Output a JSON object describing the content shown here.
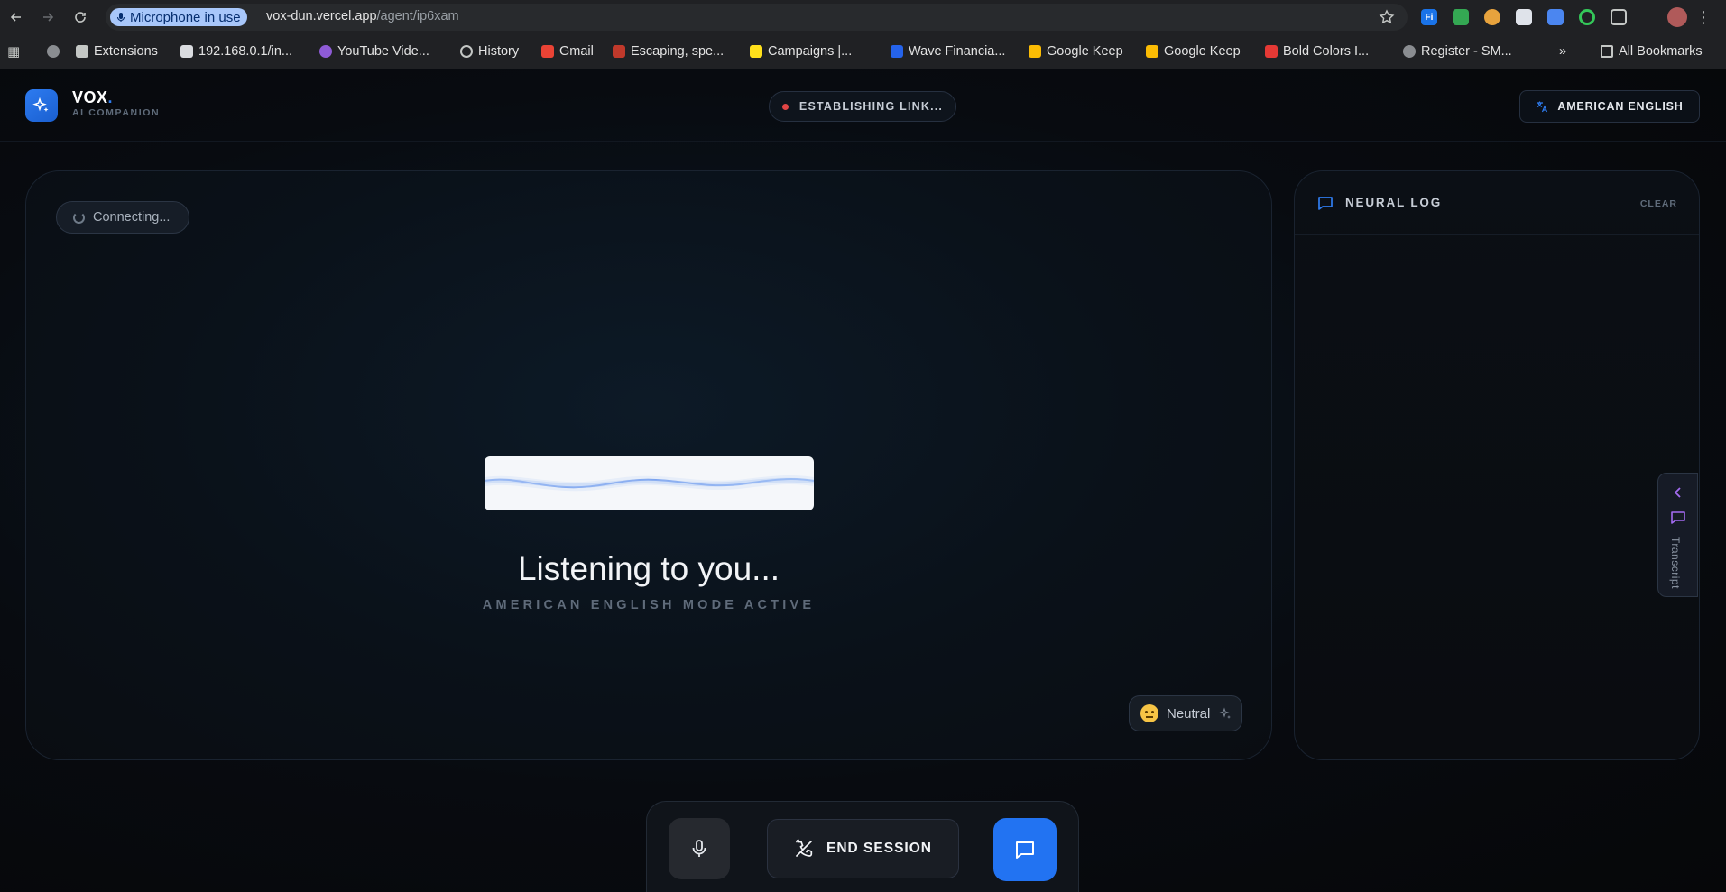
{
  "browser": {
    "mic_chip": "Microphone in use",
    "url_host": "vox-dun.vercel.app",
    "url_path": "/agent/ip6xam",
    "bookmarks": [
      {
        "label": "Extensions",
        "icon": "puzzle-icon"
      },
      {
        "label": "192.168.0.1/in...",
        "icon": "router-icon"
      },
      {
        "label": "YouTube Vide...",
        "icon": "download-icon"
      },
      {
        "label": "History",
        "icon": "history-icon"
      },
      {
        "label": "Gmail",
        "icon": "gmail-icon"
      },
      {
        "label": "Escaping, spe...",
        "icon": "site-icon"
      },
      {
        "label": "Campaigns |...",
        "icon": "campaigns-icon"
      },
      {
        "label": "Wave Financia...",
        "icon": "wave-icon"
      },
      {
        "label": "Google Keep",
        "icon": "keep-icon"
      },
      {
        "label": "Google Keep",
        "icon": "keep-icon"
      },
      {
        "label": "Bold Colors I...",
        "icon": "bold-colors-icon"
      },
      {
        "label": "Register - SM...",
        "icon": "globe-icon"
      }
    ],
    "overflow": "»",
    "all_bookmarks": "All Bookmarks"
  },
  "app": {
    "brand": "VOX",
    "brand_dot": ".",
    "brand_sub": "AI COMPANION",
    "status": "ESTABLISHING LINK...",
    "language": "AMERICAN ENGLISH",
    "connection": "Connecting...",
    "listening": "Listening to you...",
    "mode": "AMERICAN ENGLISH MODE ACTIVE",
    "mood": "Neutral",
    "log_title": "NEURAL LOG",
    "log_clear": "CLEAR",
    "transcript_tab": "Transcript",
    "end_session": "END SESSION"
  },
  "colors": {
    "accent": "#2273f2",
    "status_dot": "#e04545",
    "transcript_accent": "#a36bf0"
  }
}
